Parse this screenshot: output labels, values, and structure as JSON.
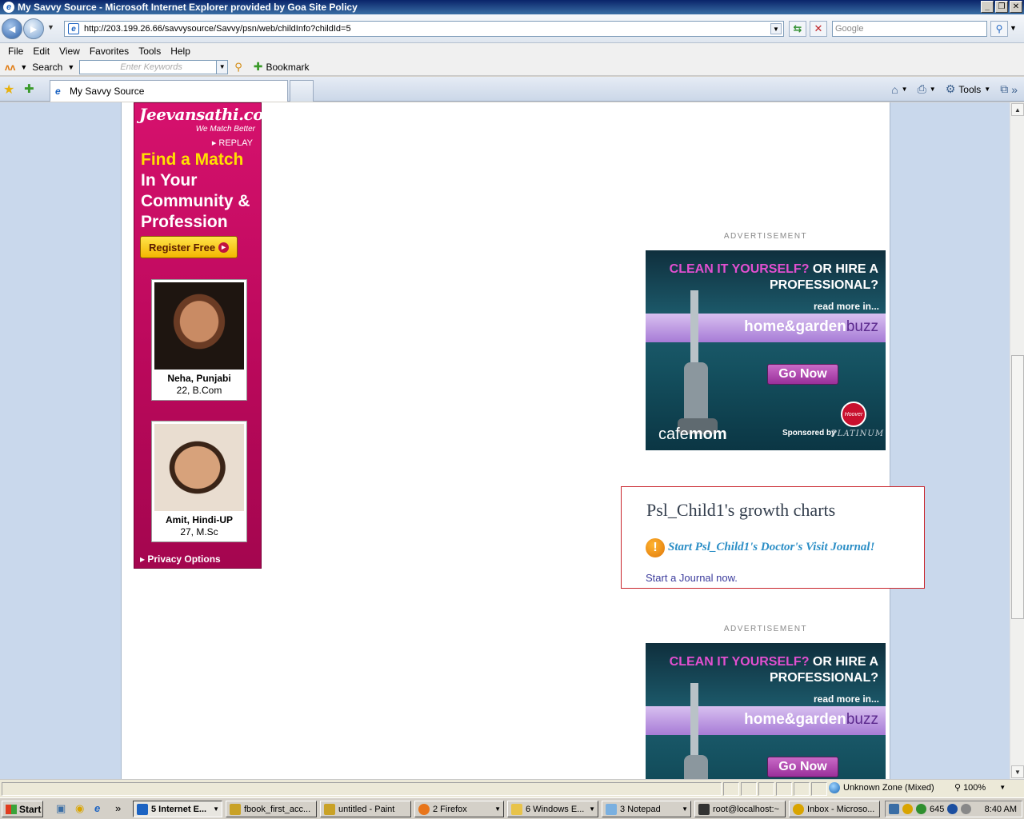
{
  "window": {
    "title": "My Savvy Source - Microsoft Internet Explorer provided by Goa Site Policy",
    "controls": [
      "_",
      "❐",
      "✕"
    ]
  },
  "address": {
    "url": "http://203.199.26.66/savvysource/Savvy/psn/web/childInfo?childId=5",
    "search_placeholder": "Google"
  },
  "menu": [
    "File",
    "Edit",
    "View",
    "Favorites",
    "Tools",
    "Help"
  ],
  "toolbar": {
    "search_label": "Search",
    "keywords_placeholder": "Enter Keywords",
    "bookmark_label": "Bookmark"
  },
  "tabs": {
    "active_label": "My Savvy Source",
    "tools_label": "Tools"
  },
  "jeevansathi_ad": {
    "logo": "Jeevansathi.com",
    "tagline": "We Match Better",
    "replay": "REPLAY",
    "headline_1": "Find a Match",
    "headline_2": "In Your Community & Profession",
    "register": "Register Free",
    "profiles": [
      {
        "name": "Neha, Punjabi",
        "details": "22, B.Com"
      },
      {
        "name": "Amit, Hindi-UP",
        "details": "27, M.Sc"
      }
    ],
    "privacy": "Privacy Options"
  },
  "ads": {
    "label": "ADVERTISEMENT",
    "headline_pink": "CLEAN IT YOURSELF?",
    "headline_rest": " OR HIRE A PROFESSIONAL?",
    "read_more": "read more in...",
    "brand": "home&garden",
    "brand_suffix": "buzz",
    "go": "Go Now",
    "cafe_a": "cafe",
    "cafe_b": "mom",
    "sponsored": "Sponsored by",
    "hoover": "Hoover",
    "platinum": "PLATINUM"
  },
  "growth": {
    "title": "Psl_Child1's growth charts",
    "journal_prompt": "Start Psl_Child1's Doctor's Visit Journal!",
    "journal_link": "Start a Journal now."
  },
  "statusbar": {
    "zone": "Unknown Zone (Mixed)",
    "zoom": "100%"
  },
  "taskbar": {
    "start": "Start",
    "tasks": [
      "5 Internet E...",
      "fbook_first_acc...",
      "untitled - Paint",
      "2 Firefox",
      "6 Windows E...",
      "3 Notepad",
      "root@localhost:~",
      "Inbox - Microso..."
    ],
    "tray_badge": "645",
    "clock": "8:40 AM"
  },
  "colors": {
    "ie_blue": "#0a246a",
    "jeevansathi_pink": "#d6116d",
    "highlight_yellow": "#ffe000",
    "growth_border": "#c9252c",
    "journal_link": "#2b8ec6",
    "cafemom_teal": "#1d5d6e"
  }
}
